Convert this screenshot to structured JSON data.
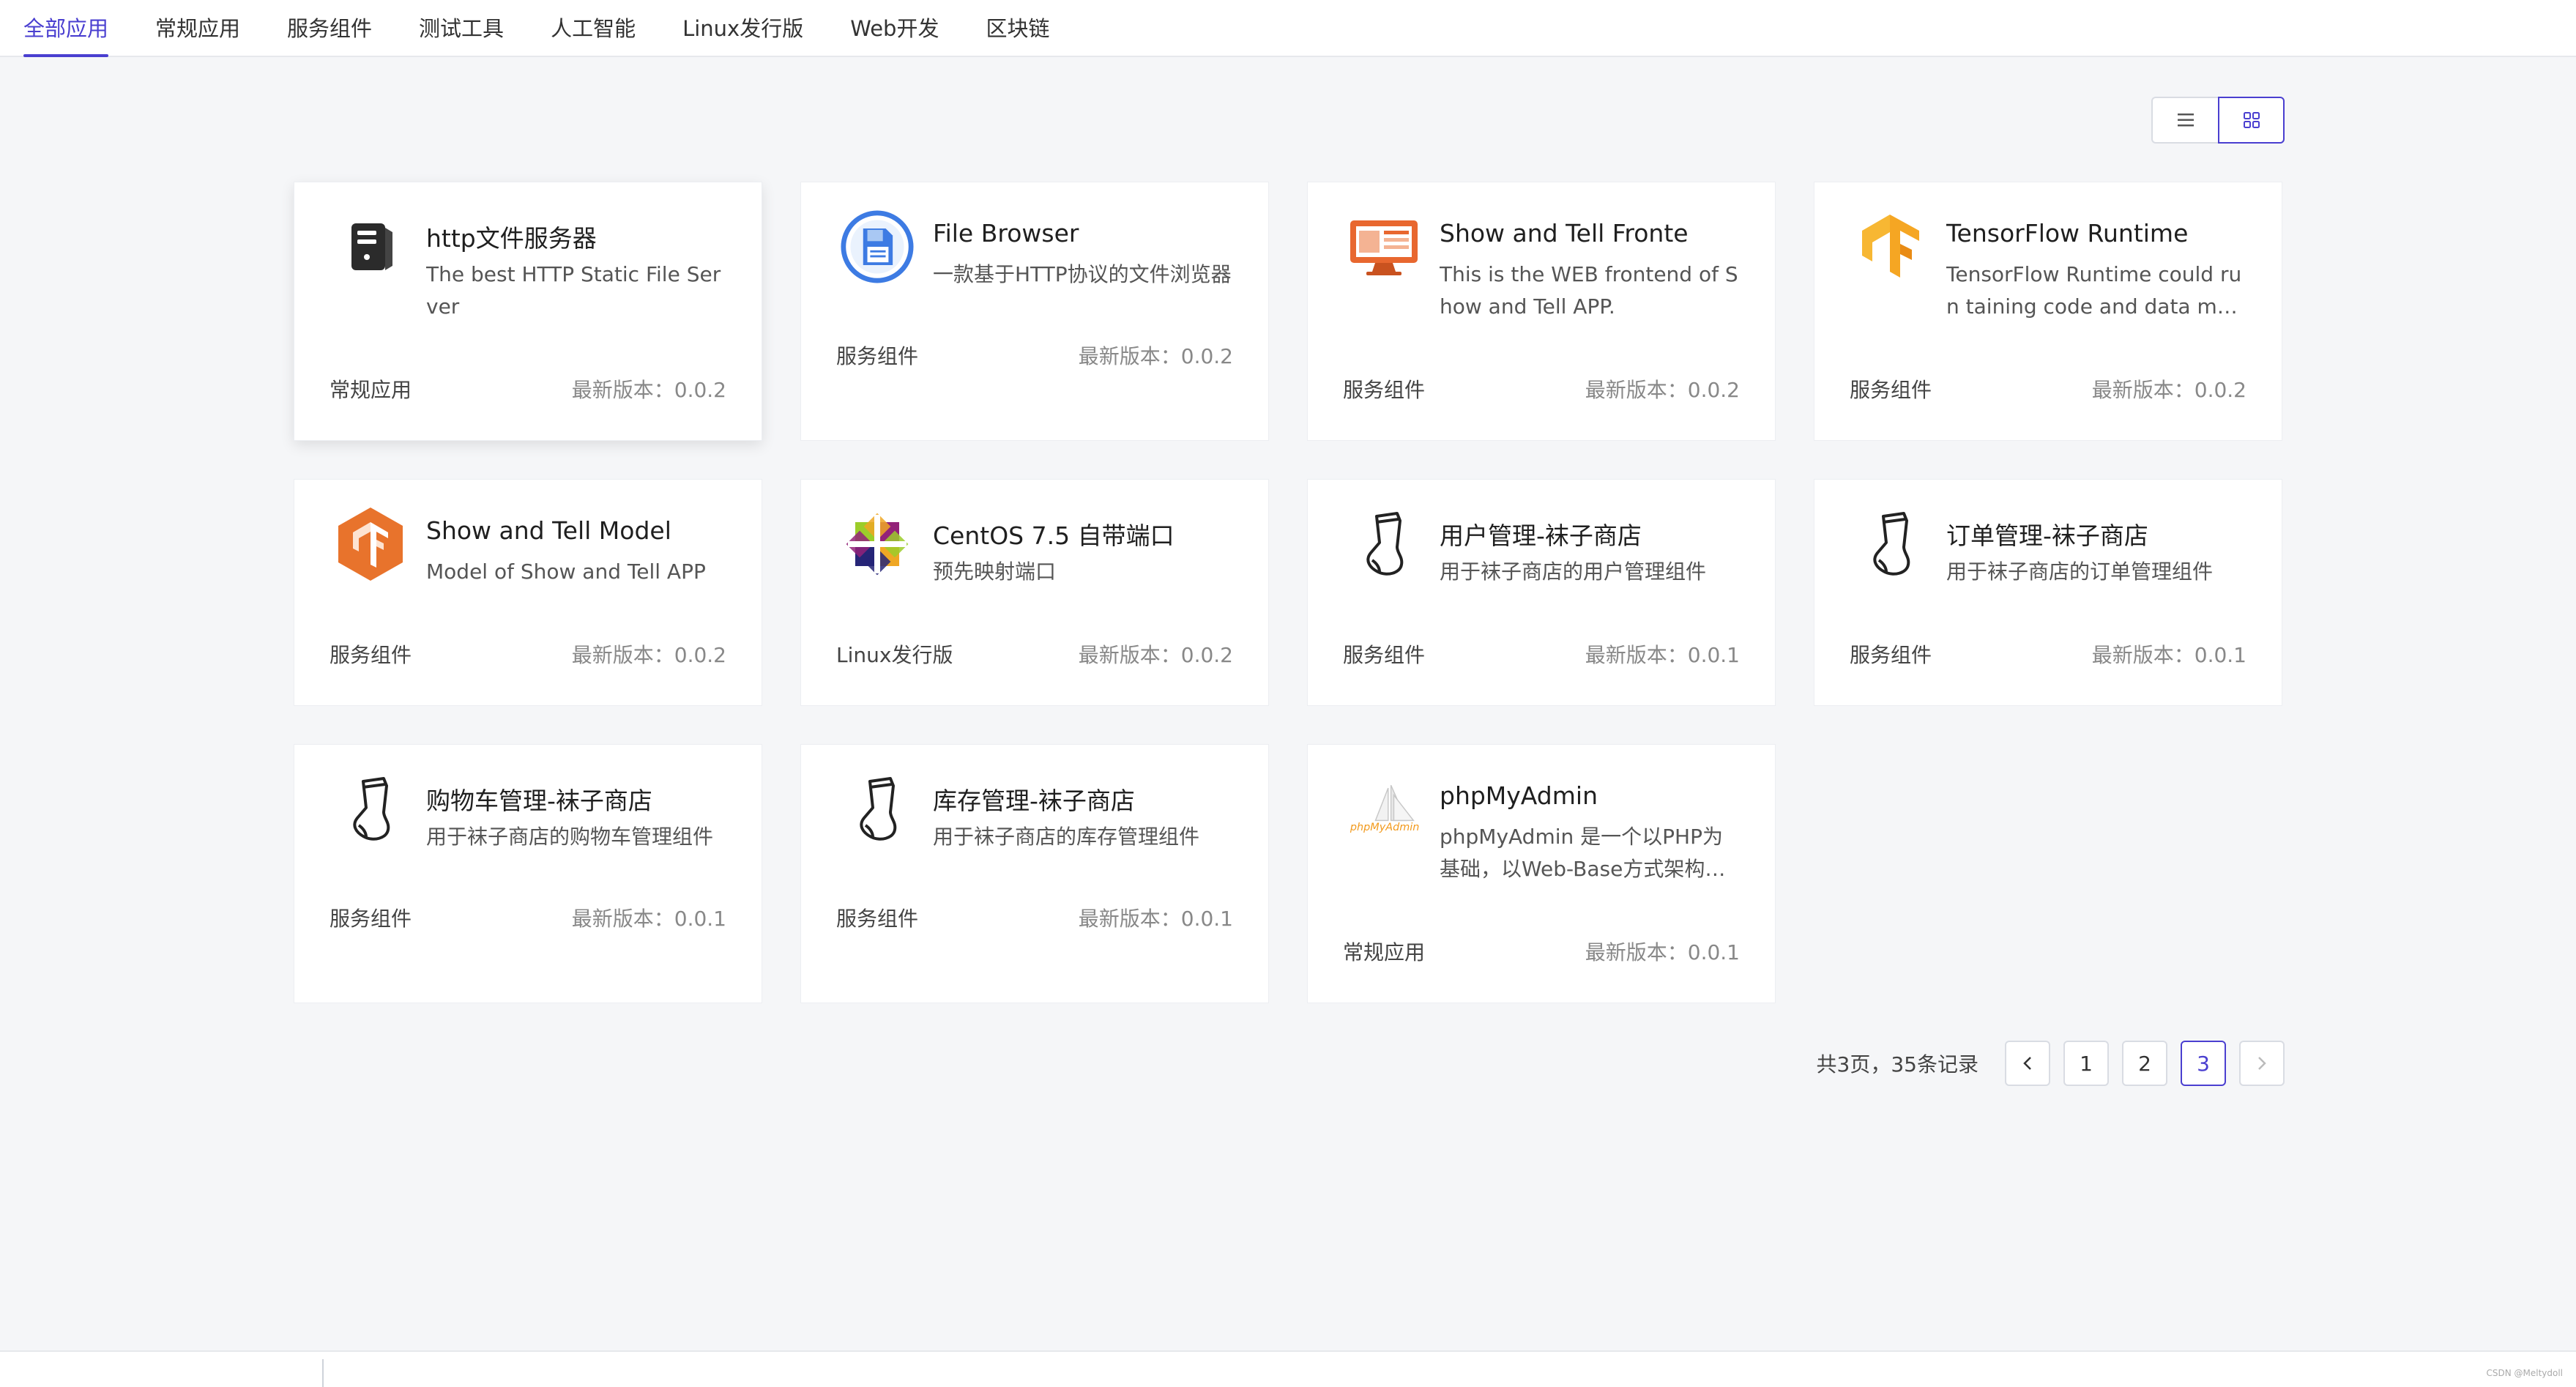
{
  "tabs": [
    {
      "label": "全部应用",
      "active": true
    },
    {
      "label": "常规应用"
    },
    {
      "label": "服务组件"
    },
    {
      "label": "测试工具"
    },
    {
      "label": "人工智能"
    },
    {
      "label": "Linux发行版"
    },
    {
      "label": "Web开发"
    },
    {
      "label": "区块链"
    }
  ],
  "view_toggle": {
    "list_icon": "list-icon",
    "grid_icon": "grid-icon",
    "active": "grid"
  },
  "cards": [
    {
      "title": "http文件服务器",
      "desc": "The best HTTP Static File Server",
      "category": "常规应用",
      "version": "最新版本：0.0.2",
      "icon": "server-icon"
    },
    {
      "title": "File Browser",
      "desc": "一款基于HTTP协议的文件浏览器",
      "category": "服务组件",
      "version": "最新版本：0.0.2",
      "icon": "file-browser-icon"
    },
    {
      "title": "Show and Tell Fronte",
      "desc": "This is the WEB frontend of Show and Tell APP.",
      "category": "服务组件",
      "version": "最新版本：0.0.2",
      "icon": "monitor-icon"
    },
    {
      "title": "TensorFlow Runtime",
      "desc": "TensorFlow Runtime could run taining code and data models.",
      "category": "服务组件",
      "version": "最新版本：0.0.2",
      "icon": "tensorflow-icon"
    },
    {
      "title": "Show and Tell Model",
      "desc": "Model of Show and Tell APP",
      "category": "服务组件",
      "version": "最新版本：0.0.2",
      "icon": "tensorflow-hexagon-icon"
    },
    {
      "title": "CentOS 7.5 自带端口",
      "desc": "预先映射端口",
      "category": "Linux发行版",
      "version": "最新版本：0.0.2",
      "icon": "centos-icon"
    },
    {
      "title": "用户管理-袜子商店",
      "desc": "用于袜子商店的用户管理组件",
      "category": "服务组件",
      "version": "最新版本：0.0.1",
      "icon": "sock-icon"
    },
    {
      "title": "订单管理-袜子商店",
      "desc": "用于袜子商店的订单管理组件",
      "category": "服务组件",
      "version": "最新版本：0.0.1",
      "icon": "sock-icon"
    },
    {
      "title": "购物车管理-袜子商店",
      "desc": "用于袜子商店的购物车管理组件",
      "category": "服务组件",
      "version": "最新版本：0.0.1",
      "icon": "sock-icon"
    },
    {
      "title": "库存管理-袜子商店",
      "desc": "用于袜子商店的库存管理组件",
      "category": "服务组件",
      "version": "最新版本：0.0.1",
      "icon": "sock-icon"
    },
    {
      "title": "phpMyAdmin",
      "desc": "phpMyAdmin 是一个以PHP为基础，以Web-Base方式架构在网站主机上的MySQL的数据库管理工具",
      "category": "常规应用",
      "version": "最新版本：0.0.1",
      "icon": "phpmyadmin-icon",
      "logo_text": "phpMyAdmin"
    }
  ],
  "pagination": {
    "total_text": "共3页，35条记录",
    "prev": "<",
    "pages": [
      "1",
      "2",
      "3"
    ],
    "current": "3",
    "next": ">"
  },
  "watermark": "CSDN @Meltydoll"
}
